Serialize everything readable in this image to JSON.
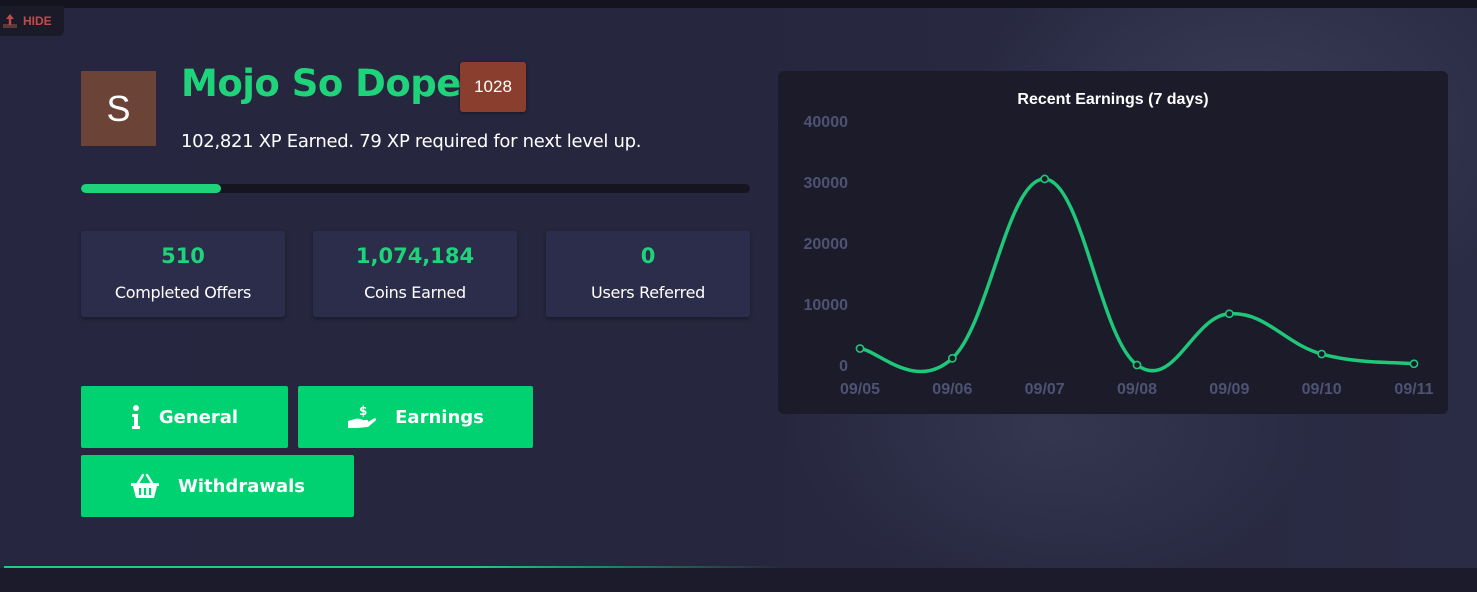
{
  "hide_label": "HIDE",
  "profile": {
    "avatar_letter": "S",
    "username": "Mojo So Dope",
    "level": "1028",
    "xp_text": "102,821 XP Earned. 79 XP required for next level up.",
    "progress_fraction": 0.21
  },
  "stats": [
    {
      "value": "510",
      "label": "Completed Offers"
    },
    {
      "value": "1,074,184",
      "label": "Coins Earned"
    },
    {
      "value": "0",
      "label": "Users Referred"
    }
  ],
  "nav": {
    "general_label": "General",
    "general_icon": "info-icon",
    "earnings_label": "Earnings",
    "earnings_icon": "hand-dollar-icon",
    "withdrawals_label": "Withdrawals",
    "withdrawals_icon": "basket-icon"
  },
  "colors": {
    "accent": "#00d271",
    "badge": "#8a3f2e",
    "avatar": "#6b4437",
    "hide": "#c24a4a"
  },
  "chart_data": {
    "type": "line",
    "title": "Recent Earnings (7 days)",
    "categories": [
      "09/05",
      "09/06",
      "09/07",
      "09/08",
      "09/09",
      "09/10",
      "09/11"
    ],
    "values": [
      2700,
      1100,
      30500,
      0,
      8400,
      1800,
      200
    ],
    "yticks": [
      0,
      10000,
      20000,
      30000,
      40000
    ],
    "ylim": [
      0,
      40000
    ],
    "xlabel": "",
    "ylabel": "",
    "grid": false,
    "legend": "none",
    "line_color": "#1fc77a",
    "tick_color": "#4e5273"
  }
}
